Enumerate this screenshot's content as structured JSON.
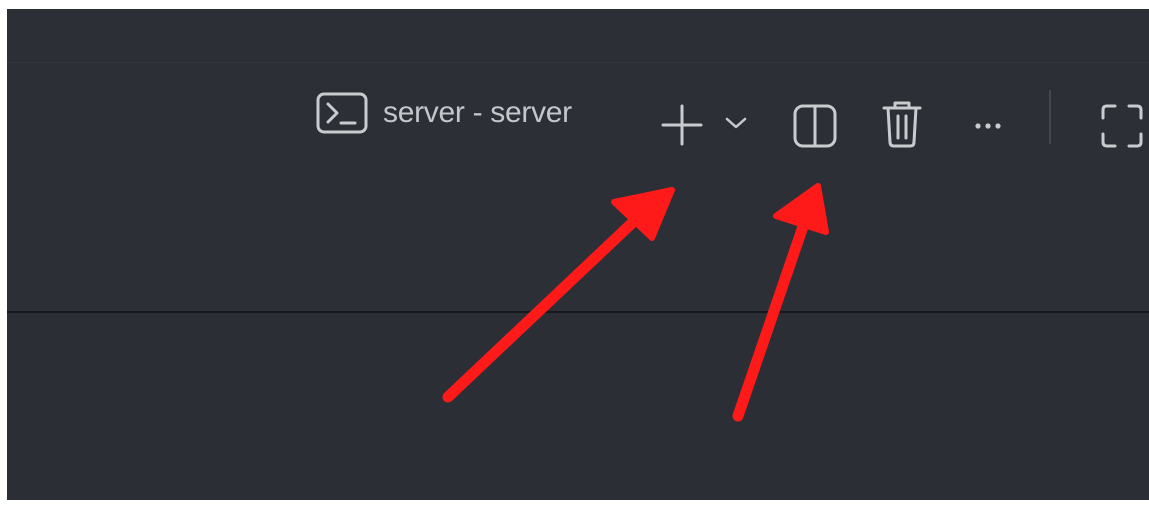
{
  "terminal": {
    "tab_label": "server - server",
    "tab_icon": "terminal-icon"
  },
  "toolbar": {
    "new_terminal_icon": "plus-icon",
    "profile_dropdown_icon": "chevron-down-icon",
    "split_icon": "split-editor-icon",
    "delete_icon": "trash-icon",
    "more_icon": "ellipsis-icon",
    "maximize_icon": "maximize-icon"
  },
  "annotations": {
    "arrow_color": "#ff0000"
  },
  "colors": {
    "panel_bg": "#2c2f35",
    "icon_fg": "#c9cbcf"
  }
}
